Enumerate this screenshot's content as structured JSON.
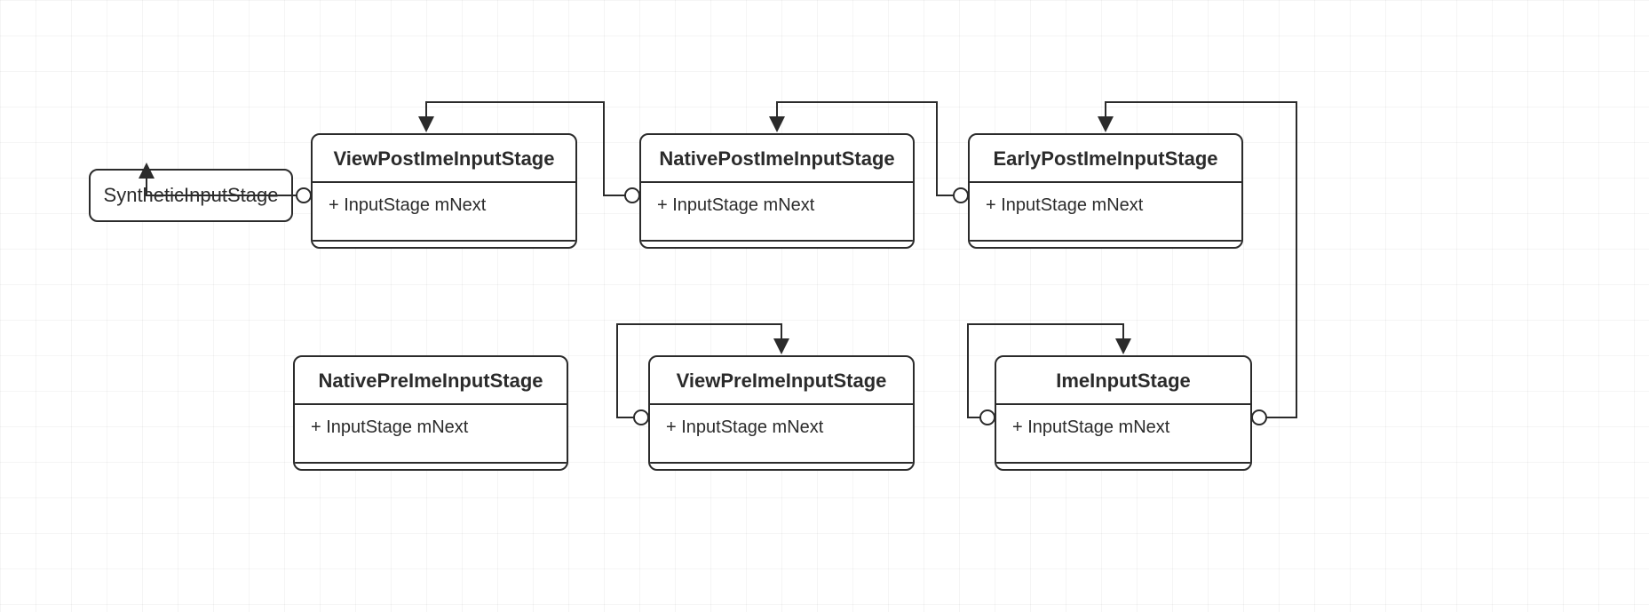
{
  "diagram": {
    "type": "uml-class-chain",
    "nodes": {
      "synthetic": {
        "label": "SyntheticInputStage"
      },
      "viewPost": {
        "title": "ViewPostImeInputStage",
        "attr": "+ InputStage mNext"
      },
      "nativePost": {
        "title": "NativePostImeInputStage",
        "attr": "+ InputStage mNext"
      },
      "earlyPost": {
        "title": "EarlyPostImeInputStage",
        "attr": "+ InputStage mNext"
      },
      "nativePre": {
        "title": "NativePreImeInputStage",
        "attr": "+ InputStage mNext"
      },
      "viewPre": {
        "title": "ViewPreImeInputStage",
        "attr": "+ InputStage mNext"
      },
      "ime": {
        "title": "ImeInputStage",
        "attr": "+ InputStage mNext"
      }
    },
    "edges_desc": "Each class's mNext points to the previous stage; arrows go right-to-left along the top row, then down to ImeInputStage, then right-to-left along the bottom row."
  }
}
